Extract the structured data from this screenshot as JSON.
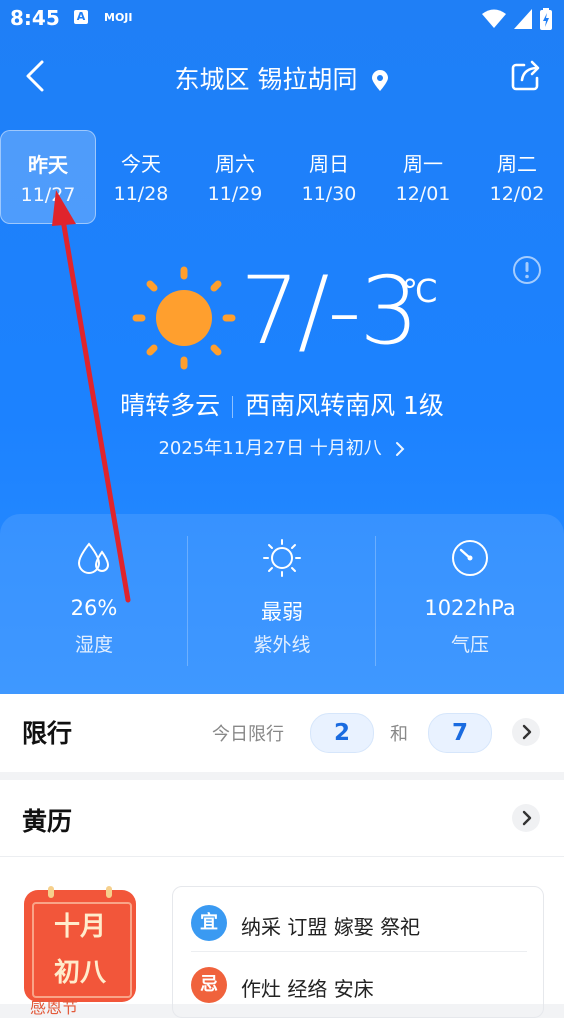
{
  "status": {
    "time": "8:45",
    "a_label": "A",
    "moji_label": "MOJI"
  },
  "header": {
    "location": "东城区 锡拉胡同"
  },
  "days": [
    {
      "name": "昨天",
      "date": "11/27",
      "selected": true
    },
    {
      "name": "今天",
      "date": "11/28"
    },
    {
      "name": "周六",
      "date": "11/29"
    },
    {
      "name": "周日",
      "date": "11/30"
    },
    {
      "name": "周一",
      "date": "12/01"
    },
    {
      "name": "周二",
      "date": "12/02"
    }
  ],
  "weather": {
    "temp_range": "7/-3",
    "unit": "℃",
    "condition": "晴转多云",
    "wind": "西南风转南风 1级",
    "date_line": "2025年11月27日 十月初八",
    "icon": "sun-icon"
  },
  "metrics": [
    {
      "value": "26%",
      "label": "湿度",
      "icon": "humidity-icon"
    },
    {
      "value": "最弱",
      "label": "紫外线",
      "icon": "uv-icon"
    },
    {
      "value": "1022hPa",
      "label": "气压",
      "icon": "pressure-icon"
    }
  ],
  "restriction": {
    "title": "限行",
    "today_label": "今日限行",
    "num1": "2",
    "and_label": "和",
    "num2": "7"
  },
  "almanac": {
    "title": "黄历",
    "calendar_line1": "十月",
    "calendar_line2": "初八",
    "below_text": "感恩节",
    "yi_badge": "宜",
    "yi": "纳采 订盟 嫁娶 祭祀",
    "ji_badge": "忌",
    "ji": "作灶 经络 安床"
  },
  "colors": {
    "header_blue": "#1f7ff6",
    "sun": "#ff9f2e",
    "pill_text": "#1a6be0",
    "yi": "#3a9af2",
    "ji": "#f0623c",
    "annotation_arrow": "#e0242c"
  }
}
